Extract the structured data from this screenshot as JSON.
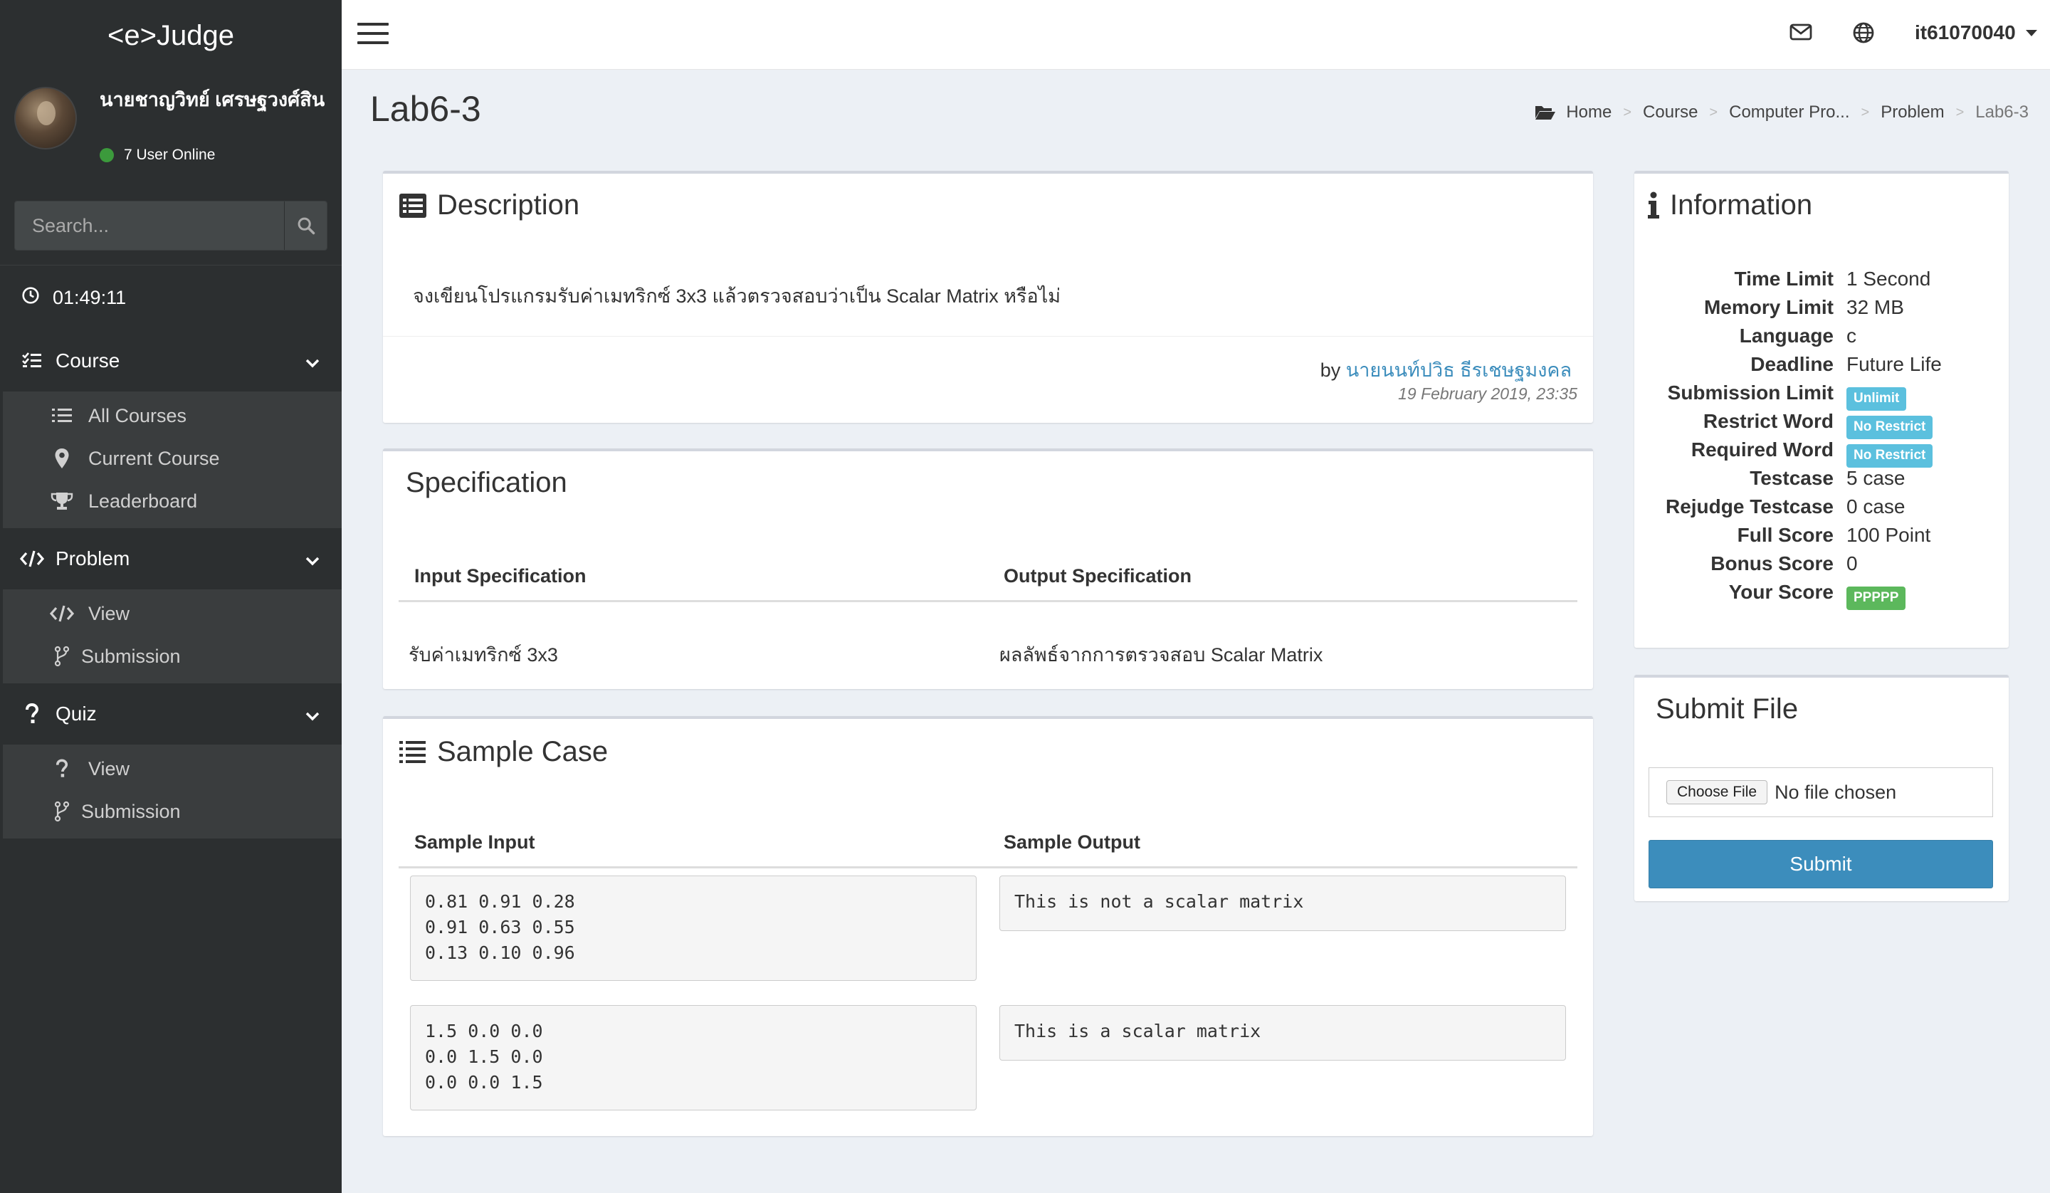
{
  "app": {
    "logo": "<e>Judge",
    "user_name": "นายชาญวิทย์ เศรษฐวงศ์สิน",
    "online_text": "7 User Online",
    "search_placeholder": "Search...",
    "timer": "01:49:11"
  },
  "sidebar": {
    "sections": [
      {
        "label": "Course",
        "icon": "tasks-icon",
        "items": [
          {
            "label": "All Courses",
            "icon": "list-icon"
          },
          {
            "label": "Current Course",
            "icon": "map-marker-icon"
          },
          {
            "label": "Leaderboard",
            "icon": "trophy-icon"
          }
        ]
      },
      {
        "label": "Problem",
        "icon": "code-icon",
        "items": [
          {
            "label": "View",
            "icon": "code-icon"
          },
          {
            "label": "Submission",
            "icon": "code-fork-icon"
          }
        ]
      },
      {
        "label": "Quiz",
        "icon": "question-icon",
        "items": [
          {
            "label": "View",
            "icon": "question-icon"
          },
          {
            "label": "Submission",
            "icon": "code-fork-icon"
          }
        ]
      }
    ]
  },
  "topbar": {
    "username": "it61070040",
    "icons": [
      "envelope-icon",
      "globe-icon"
    ]
  },
  "page": {
    "title": "Lab6-3",
    "breadcrumb": [
      "Home",
      "Course",
      "Computer Pro...",
      "Problem",
      "Lab6-3"
    ]
  },
  "description": {
    "title": "Description",
    "text": "จงเขียนโปรแกรมรับค่าเมทริกซ์ 3x3 แล้วตรวจสอบว่าเป็น Scalar Matrix หรือไม่",
    "by_prefix": "by",
    "author": "นายนนท์ปวิธ ธีรเชษฐมงคล",
    "date": "19 February 2019, 23:35"
  },
  "specification": {
    "title": "Specification",
    "input_header": "Input Specification",
    "output_header": "Output Specification",
    "input": "รับค่าเมทริกซ์ 3x3",
    "output": "ผลลัพธ์จากการตรวจสอบ Scalar Matrix"
  },
  "samples": {
    "title": "Sample Case",
    "input_header": "Sample Input",
    "output_header": "Sample Output",
    "cases": [
      {
        "input": "0.81 0.91 0.28\n0.91 0.63 0.55\n0.13 0.10 0.96",
        "output": "This is not a scalar matrix"
      },
      {
        "input": "1.5 0.0 0.0\n0.0 1.5 0.0\n0.0 0.0 1.5",
        "output": "This is a scalar matrix"
      }
    ]
  },
  "information": {
    "title": "Information",
    "rows": [
      {
        "key": "Time Limit",
        "value": "1 Second"
      },
      {
        "key": "Memory Limit",
        "value": "32 MB"
      },
      {
        "key": "Language",
        "value": "c"
      },
      {
        "key": "Deadline",
        "value": "Future Life"
      },
      {
        "key": "Submission Limit",
        "badge": "Unlimit",
        "badge_color": "#5bc0de"
      },
      {
        "key": "Restrict Word",
        "badge": "No Restrict",
        "badge_color": "#5bc0de"
      },
      {
        "key": "Required Word",
        "badge": "No Restrict",
        "badge_color": "#5bc0de"
      },
      {
        "key": "Testcase",
        "value": "5 case"
      },
      {
        "key": "Rejudge Testcase",
        "value": "0 case"
      },
      {
        "key": "Full Score",
        "value": "100 Point"
      },
      {
        "key": "Bonus Score",
        "value": "0"
      },
      {
        "key": "Your Score",
        "badge": "PPPPP",
        "badge_color": "#5cb85c"
      }
    ]
  },
  "submit": {
    "title": "Submit File",
    "choose_label": "Choose File",
    "no_file": "No file chosen",
    "button": "Submit"
  },
  "colors": {
    "sidebar_bg": "#2c2f30",
    "sidebar_sub_bg": "#3a3d3e",
    "primary": "#3c8dbc",
    "badge_info": "#5bc0de",
    "badge_success": "#5cb85c",
    "online": "#3c9a3c"
  }
}
